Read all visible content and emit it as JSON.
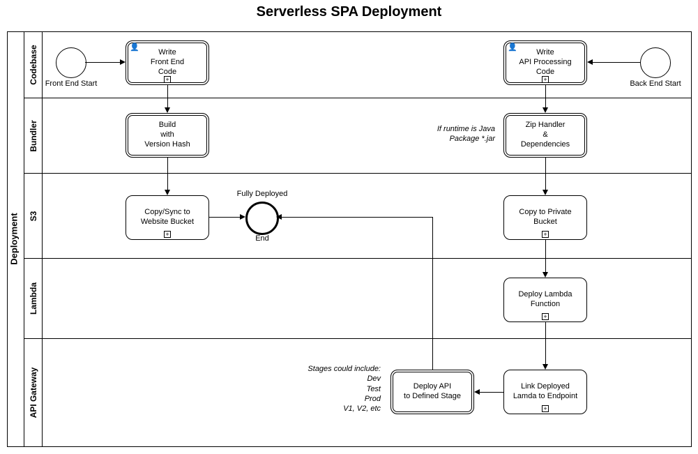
{
  "title": "Serverless SPA Deployment",
  "pool": "Deployment",
  "lanes": [
    "Codebase",
    "Bundler",
    "S3",
    "Lambda",
    "API Gateway"
  ],
  "events": {
    "fe_start": "Front End Start",
    "be_start": "Back End Start",
    "end_top": "Fully Deployed",
    "end_bottom": "End"
  },
  "tasks": {
    "fe_code": "Write\nFront End\nCode",
    "be_code": "Write\nAPI Processing\nCode",
    "build": "Build\nwith\nVersion Hash",
    "zip": "Zip Handler\n&\nDependencies",
    "copy_web": "Copy/Sync to\nWebsite Bucket",
    "copy_priv": "Copy to Private\nBucket",
    "deploy_lambda": "Deploy Lambda\nFunction",
    "link": "Link Deployed\nLamda to Endpoint",
    "deploy_api": "Deploy API\nto Defined Stage"
  },
  "annotations": {
    "java": "If runtime is Java\nPackage *.jar",
    "stages": "Stages could include:\nDev\nTest\nProd\nV1, V2, etc"
  }
}
